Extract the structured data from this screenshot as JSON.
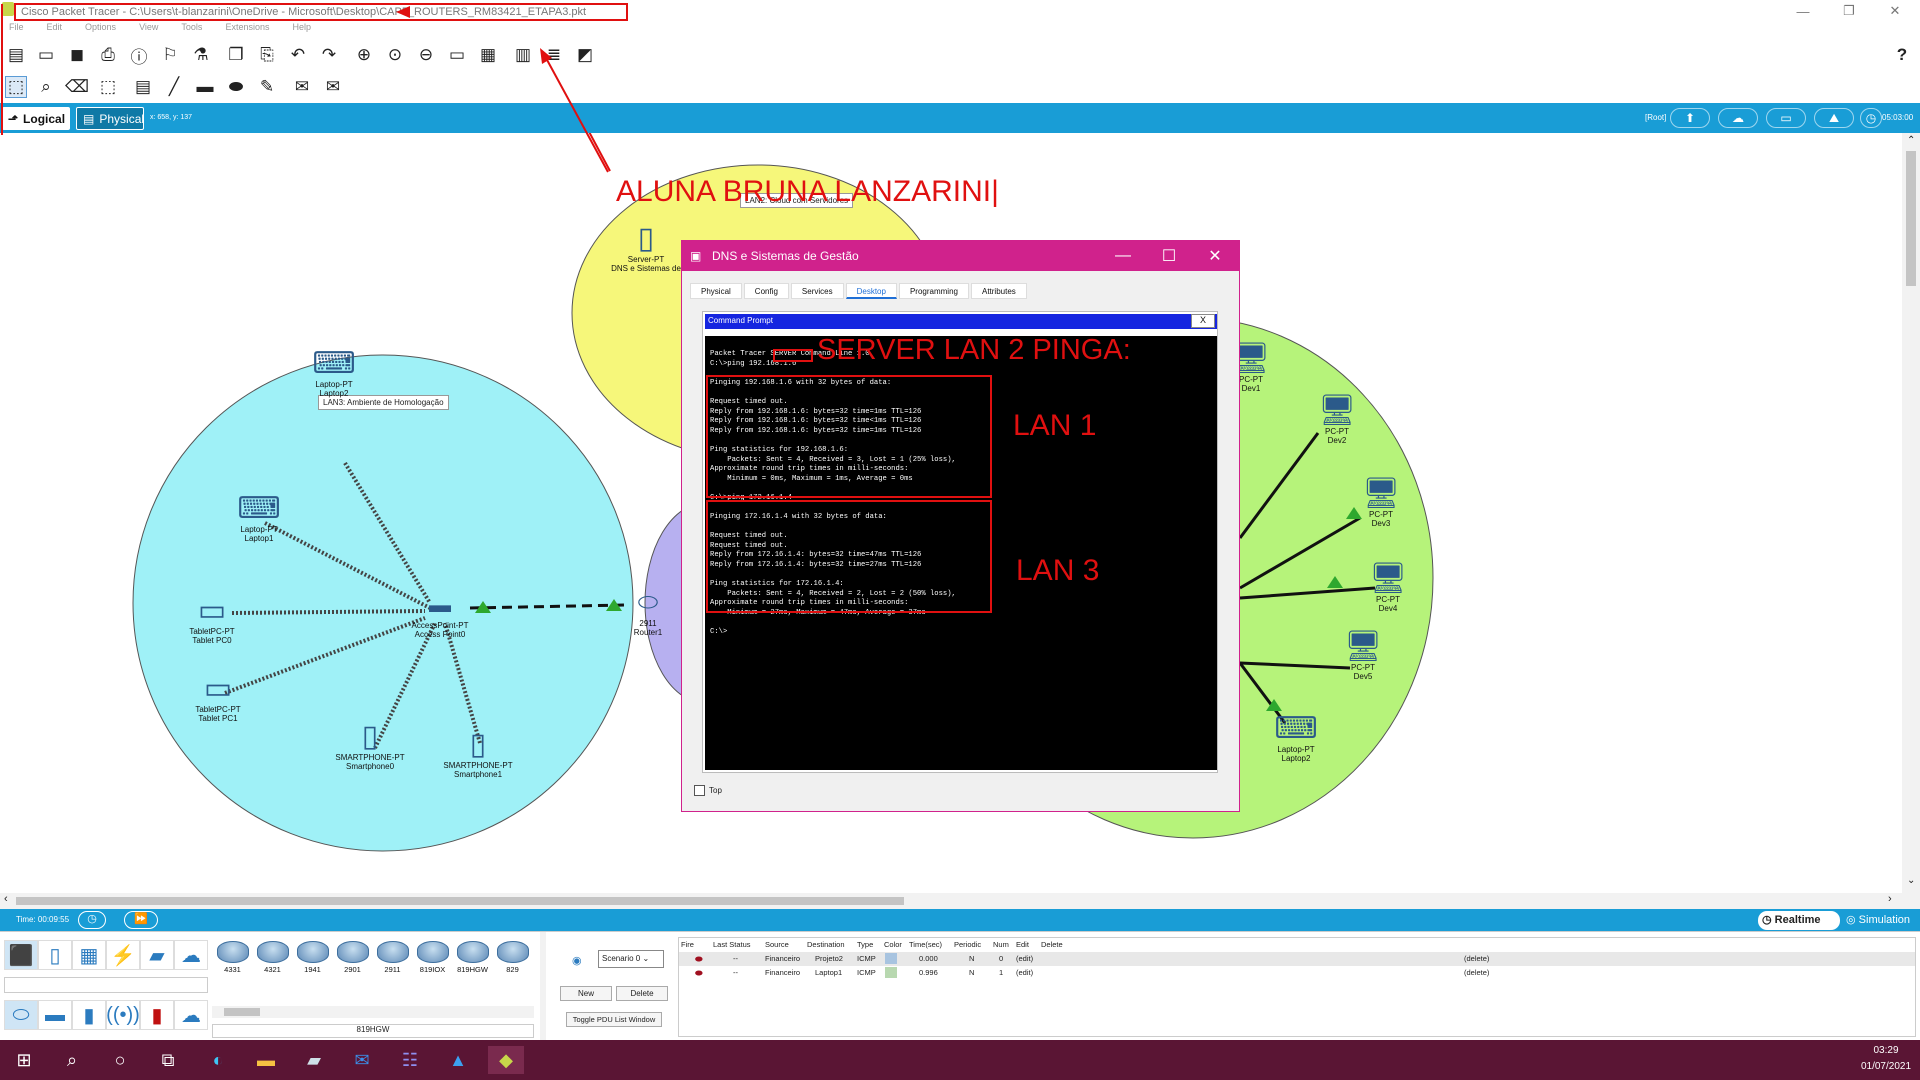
{
  "window": {
    "title": "Cisco Packet Tracer - C:\\Users\\t-blanzarini\\OneDrive - Microsoft\\Desktop\\CAP5_ROUTERS_RM83421_ETAPA3.pkt",
    "min": "—",
    "max": "❐",
    "close": "✕"
  },
  "menu": [
    "File",
    "Edit",
    "Options",
    "View",
    "Tools",
    "Extensions",
    "Help"
  ],
  "help_icon": "?",
  "view_tabs": {
    "logical": "Logical",
    "physical": "Physical",
    "coords": "x: 658, y: 137",
    "root": "[Root]",
    "time": "05:03:00"
  },
  "annotations": {
    "author": "ALUNA BRUNA LANZARINI|",
    "server": "SERVER LAN 2 PINGA:",
    "lan1": "LAN 1",
    "lan3": "LAN 3"
  },
  "clouds": {
    "lan3": "LAN3: Ambiente de Homologação",
    "lan2": "LAN2: Cloud com Servidores"
  },
  "devices": [
    {
      "id": "server",
      "label": "Server-PT\nDNS e Sistemas de"
    },
    {
      "id": "laptop2",
      "label": "Laptop-PT\nLaptop2"
    },
    {
      "id": "laptop1",
      "label": "Laptop-PT\nLaptop1"
    },
    {
      "id": "tablet0",
      "label": "TabletPC-PT\nTablet PC0"
    },
    {
      "id": "tablet1",
      "label": "TabletPC-PT\nTablet PC1"
    },
    {
      "id": "ap",
      "label": "AccessPoint-PT\nAccess Point0"
    },
    {
      "id": "smart0",
      "label": "SMARTPHONE-PT\nSmartphone0"
    },
    {
      "id": "smart1",
      "label": "SMARTPHONE-PT\nSmartphone1"
    },
    {
      "id": "router",
      "label": "2911\nRouter1"
    },
    {
      "id": "dev1",
      "label": "PC-PT\nDev1"
    },
    {
      "id": "dev2",
      "label": "PC-PT\nDev2"
    },
    {
      "id": "dev3",
      "label": "PC-PT\nDev3"
    },
    {
      "id": "dev4",
      "label": "PC-PT\nDev4"
    },
    {
      "id": "dev5",
      "label": "PC-PT\nDev5"
    },
    {
      "id": "laptop_p2",
      "label": "Laptop-PT\nLaptop2"
    }
  ],
  "dns_window": {
    "title": "DNS e Sistemas de Gestão",
    "tabs": [
      "Physical",
      "Config",
      "Services",
      "Desktop",
      "Programming",
      "Attributes"
    ],
    "cmd_title": "Command Prompt",
    "cmd_close": "X",
    "cmd_text": "Packet Tracer SERVER Command Line 1.0\nC:\\>ping 192.168.1.6\n\nPinging 192.168.1.6 with 32 bytes of data:\n\nRequest timed out.\nReply from 192.168.1.6: bytes=32 time=1ms TTL=126\nReply from 192.168.1.6: bytes=32 time<1ms TTL=126\nReply from 192.168.1.6: bytes=32 time=1ms TTL=126\n\nPing statistics for 192.168.1.6:\n    Packets: Sent = 4, Received = 3, Lost = 1 (25% loss),\nApproximate round trip times in milli-seconds:\n    Minimum = 0ms, Maximum = 1ms, Average = 0ms\n\nC:\\>ping 172.16.1.4\n\nPinging 172.16.1.4 with 32 bytes of data:\n\nRequest timed out.\nRequest timed out.\nReply from 172.16.1.4: bytes=32 time=47ms TTL=126\nReply from 172.16.1.4: bytes=32 time=27ms TTL=126\n\nPing statistics for 172.16.1.4:\n    Packets: Sent = 4, Received = 2, Lost = 2 (50% loss),\nApproximate round trip times in milli-seconds:\n    Minimum = 27ms, Maximum = 47ms, Average = 37ms\n\nC:\\>",
    "top_label": "Top"
  },
  "sim": {
    "time": "Time: 00:09:55",
    "realtime": "Realtime",
    "simulation": "Simulation"
  },
  "palette": {
    "models": [
      "4331",
      "4321",
      "1941",
      "2901",
      "2911",
      "819IOX",
      "819HGW",
      "829"
    ],
    "selected": "819HGW"
  },
  "scenario": {
    "value": "Scenario 0",
    "new": "New",
    "delete": "Delete",
    "toggle": "Toggle PDU List Window"
  },
  "pdu": {
    "headers": [
      "Fire",
      "Last Status",
      "Source",
      "Destination",
      "Type",
      "Color",
      "Time(sec)",
      "Periodic",
      "Num",
      "Edit",
      "Delete"
    ],
    "rows": [
      {
        "status": "--",
        "source": "Financeiro",
        "dest": "Projeto2",
        "type": "ICMP",
        "color": "#a8c4e0",
        "time": "0.000",
        "periodic": "N",
        "num": "0",
        "edit": "(edit)",
        "del": "(delete)"
      },
      {
        "status": "--",
        "source": "Financeiro",
        "dest": "Laptop1",
        "type": "ICMP",
        "color": "#b8d8b0",
        "time": "0.996",
        "periodic": "N",
        "num": "1",
        "edit": "(edit)",
        "del": "(delete)"
      }
    ]
  },
  "taskbar": {
    "time": "03:29",
    "date": "01/07/2021"
  },
  "colors": {
    "accent": "#199dd6",
    "dns_title": "#d0228c",
    "lan3": "#9ff1f7",
    "lan2": "#f6f77a",
    "lan1": "#b6f37a",
    "lan_mid": "#b7b0f0",
    "taskbar": "#5a1534"
  }
}
